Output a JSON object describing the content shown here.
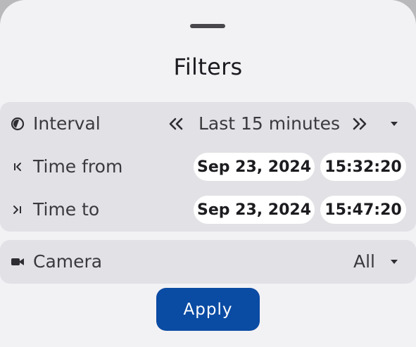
{
  "sheet": {
    "title": "Filters"
  },
  "interval": {
    "label": "Interval",
    "icon": "half-circle-icon",
    "value": "Last 15 minutes",
    "prev_icon": "double-chevron-left-icon",
    "next_icon": "double-chevron-right-icon",
    "dropdown_icon": "triangle-down-icon"
  },
  "time_from": {
    "label": "Time from",
    "icon": "skip-to-start-icon",
    "date": "Sep 23, 2024",
    "time": "15:32:20"
  },
  "time_to": {
    "label": "Time to",
    "icon": "skip-to-end-icon",
    "date": "Sep 23, 2024",
    "time": "15:47:20"
  },
  "camera": {
    "label": "Camera",
    "icon": "video-camera-icon",
    "value": "All",
    "dropdown_icon": "triangle-down-icon"
  },
  "actions": {
    "apply_label": "Apply"
  },
  "colors": {
    "sheet_bg": "#f2f1f4",
    "card_bg": "#e2e2e6",
    "chip_bg": "#ffffff",
    "primary": "#0a4ba3"
  }
}
